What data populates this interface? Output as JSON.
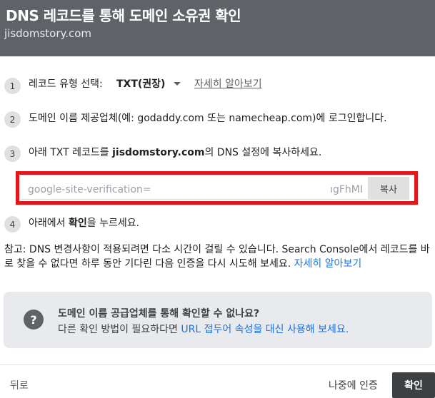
{
  "header": {
    "title": "DNS 레코드를 통해 도메인 소유권 확인",
    "domain": "jisdomstory.com"
  },
  "steps": [
    {
      "number": "1",
      "label": "레코드 유형 선택:",
      "select_value": "TXT(권장)",
      "link": "자세히 알아보기"
    },
    {
      "number": "2",
      "text": "도메인 이름 제공업체(예: godaddy.com 또는 namecheap.com)에 로그인합니다."
    },
    {
      "number": "3",
      "text_before": "아래 TXT 레코드를 ",
      "text_bold": "jisdomstory.com",
      "text_after": "의 DNS 설정에 복사하세요."
    },
    {
      "number": "4",
      "text_before": "아래에서 ",
      "text_bold": "확인",
      "text_after": "을 누르세요."
    }
  ],
  "record": {
    "value_start": "google-site-verification=",
    "value_end": "ıgFhMI",
    "copy_label": "복사"
  },
  "note": {
    "text": "참고: DNS 변경사항이 적용되려면 다소 시간이 걸릴 수 있습니다. Search Console에서 레코드를 바로 찾을 수 없다면 하루 동안 기다린 다음 인증을 다시 시도해 보세요. ",
    "link": "자세히 알아보기"
  },
  "info": {
    "icon": "help-icon",
    "title": "도메인 이름 공급업체를 통해 확인할 수 없나요?",
    "body_text": "다른 확인 방법이 필요하다면 ",
    "body_link": "URL 접두어 속성을 대신 사용해 보세요."
  },
  "footer": {
    "back_label": "뒤로",
    "later_label": "나중에 인증",
    "confirm_label": "확인"
  },
  "colors": {
    "header_bg": "#5f6368",
    "highlight": "#e3161c",
    "link": "#1a73e8",
    "info_bg": "#e8eaed"
  }
}
